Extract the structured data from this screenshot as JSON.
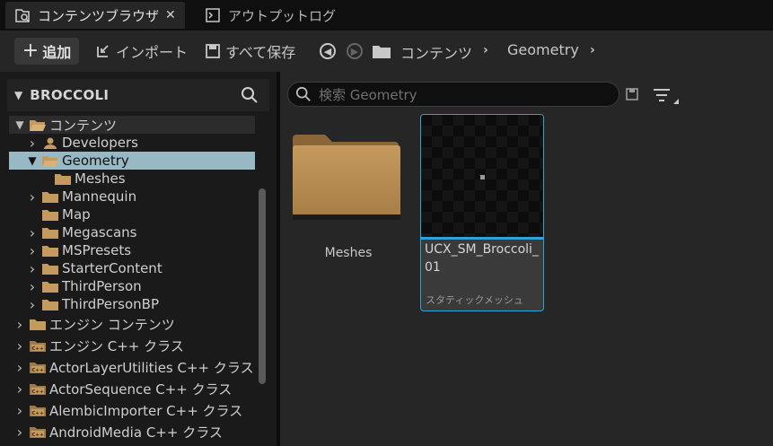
{
  "tabs": [
    {
      "label": "コンテンツブラウザ",
      "active": true,
      "icon": "content-browser-icon"
    },
    {
      "label": "アウトプットログ",
      "active": false,
      "icon": "terminal-icon"
    }
  ],
  "toolbar": {
    "add_label": "追加",
    "import_label": "インポート",
    "save_all_label": "すべて保存"
  },
  "breadcrumb": [
    "コンテンツ",
    "Geometry"
  ],
  "left_panel": {
    "title": "BROCCOLI",
    "tree": [
      {
        "label": "コンテンツ",
        "arrow": "v",
        "icon": "folder-open"
      },
      {
        "label": "Developers",
        "arrow": ">",
        "icon": "user-folder"
      },
      {
        "label": "Geometry",
        "arrow": "v",
        "icon": "folder-open",
        "selected": true
      },
      {
        "label": "Meshes",
        "arrow": "",
        "icon": "folder"
      },
      {
        "label": "Mannequin",
        "arrow": ">",
        "icon": "folder"
      },
      {
        "label": "Map",
        "arrow": "",
        "icon": "folder"
      },
      {
        "label": "Megascans",
        "arrow": ">",
        "icon": "folder"
      },
      {
        "label": "MSPresets",
        "arrow": ">",
        "icon": "folder"
      },
      {
        "label": "StarterContent",
        "arrow": ">",
        "icon": "folder"
      },
      {
        "label": "ThirdPerson",
        "arrow": ">",
        "icon": "folder"
      },
      {
        "label": "ThirdPersonBP",
        "arrow": ">",
        "icon": "folder"
      },
      {
        "label": "エンジン コンテンツ",
        "arrow": ">",
        "icon": "folder"
      },
      {
        "label": "エンジン C++ クラス",
        "arrow": ">",
        "icon": "cpp-folder"
      },
      {
        "label": "ActorLayerUtilities C++ クラス",
        "arrow": ">",
        "icon": "cpp-folder"
      },
      {
        "label": "ActorSequence C++ クラス",
        "arrow": ">",
        "icon": "cpp-folder"
      },
      {
        "label": "AlembicImporter C++ クラス",
        "arrow": ">",
        "icon": "cpp-folder"
      },
      {
        "label": "AndroidMedia C++ クラス",
        "arrow": ">",
        "icon": "cpp-folder"
      }
    ]
  },
  "right_panel": {
    "search_placeholder": "検索 Geometry",
    "items": [
      {
        "name": "Meshes",
        "kind": "folder"
      },
      {
        "name": "UCX_SM_Broccoli_01",
        "kind": "asset",
        "type_label": "スタティックメッシュ"
      }
    ]
  },
  "colors": {
    "selection": "#98b8c4",
    "asset_border": "#2ea3d6",
    "folder": "#c0955a"
  }
}
